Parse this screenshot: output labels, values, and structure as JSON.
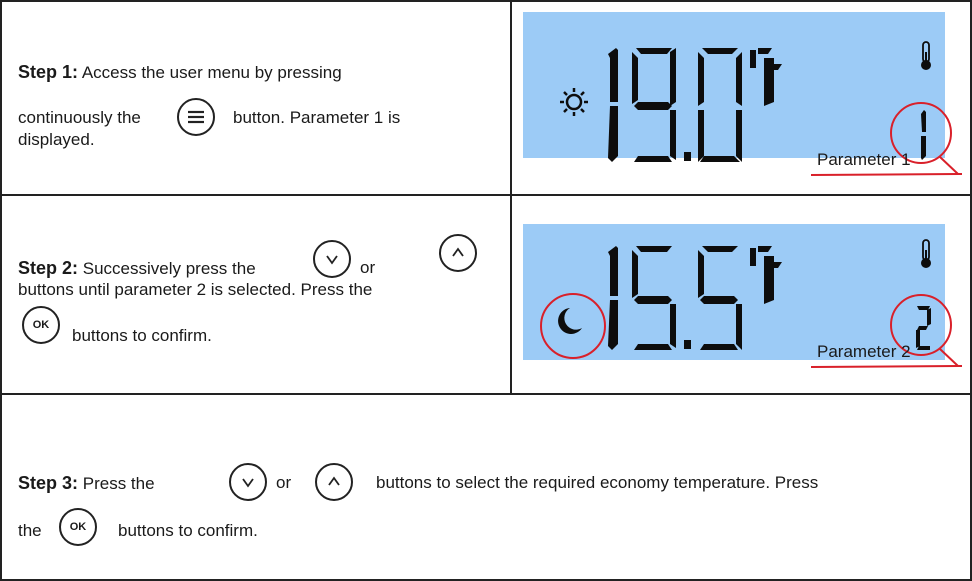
{
  "step1": {
    "label": "Step 1:",
    "line1": "Access the user menu by pressing",
    "line2a": "continuously the",
    "line2b": "button. Parameter 1 is",
    "line3": "displayed.",
    "button_icon": "menu-icon"
  },
  "display1": {
    "temperature": "19.0",
    "unit": "°C",
    "parameter_digit": "1",
    "mode_icon": "sun-icon",
    "thermometer_icon": "thermometer-icon",
    "annotation": "Parameter 1"
  },
  "step2": {
    "label": "Step 2:",
    "line1a": "Successively press the",
    "line1b": "or",
    "line2": "buttons until parameter 2 is selected. Press the",
    "line3": "buttons to confirm.",
    "ok_label": "OK"
  },
  "display2": {
    "temperature": "15.5",
    "unit": "°C",
    "parameter_digit": "2",
    "mode_icon": "moon-icon",
    "thermometer_icon": "thermometer-icon",
    "annotation": "Parameter 2"
  },
  "step3": {
    "label": "Step 3:",
    "line1a": "Press the",
    "line1b": "or",
    "line1c": "buttons to select the required economy temperature. Press",
    "line2a": "the",
    "line2b": "buttons to confirm.",
    "ok_label": "OK"
  },
  "colors": {
    "lcd_background": "#9ccbf6",
    "annotation_red": "#d9202a",
    "segment": "#0d0d0d"
  }
}
